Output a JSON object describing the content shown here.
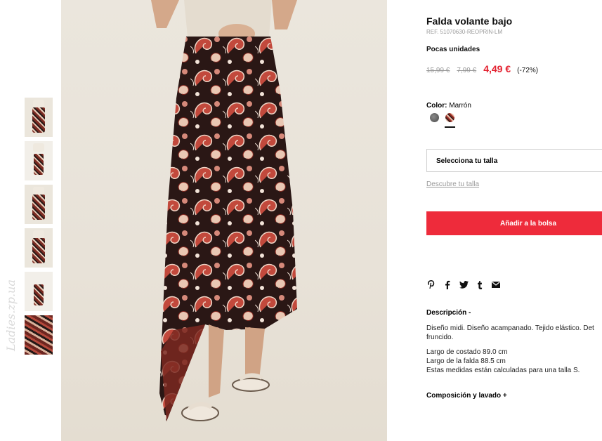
{
  "product": {
    "title": "Falda volante bajo",
    "ref": "REF. 51070630-REOPRIN-LM",
    "stock": "Pocas unidades",
    "price_original": "15,99 €",
    "price_previous": "7,99 €",
    "price_current": "4,49 €",
    "discount": "(-72%)"
  },
  "color": {
    "label": "Color:",
    "value": "Marrón",
    "swatch_colors": [
      "#6a6a6a",
      "#9c2e25"
    ]
  },
  "size": {
    "select_label": "Selecciona tu talla",
    "guide_link": "Descubre tu talla"
  },
  "cart": {
    "add_label": "Añadir a la bolsa",
    "accent": "#ee2b3b"
  },
  "share": {
    "icons": [
      "pinterest-icon",
      "facebook-icon",
      "twitter-icon",
      "tumblr-icon",
      "email-icon"
    ]
  },
  "description": {
    "heading": "Descripción -",
    "line1": "Diseño midi. Diseño acampanado. Tejido elástico. Det",
    "line2": "fruncido.",
    "measure1": "Largo de costado 89.0 cm",
    "measure2": "Largo de la falda 88.5 cm",
    "measure3": "Estas medidas están calculadas para una talla S."
  },
  "composition": {
    "heading": "Composición y lavado +"
  },
  "watermark": "Ladies.zp.ua"
}
